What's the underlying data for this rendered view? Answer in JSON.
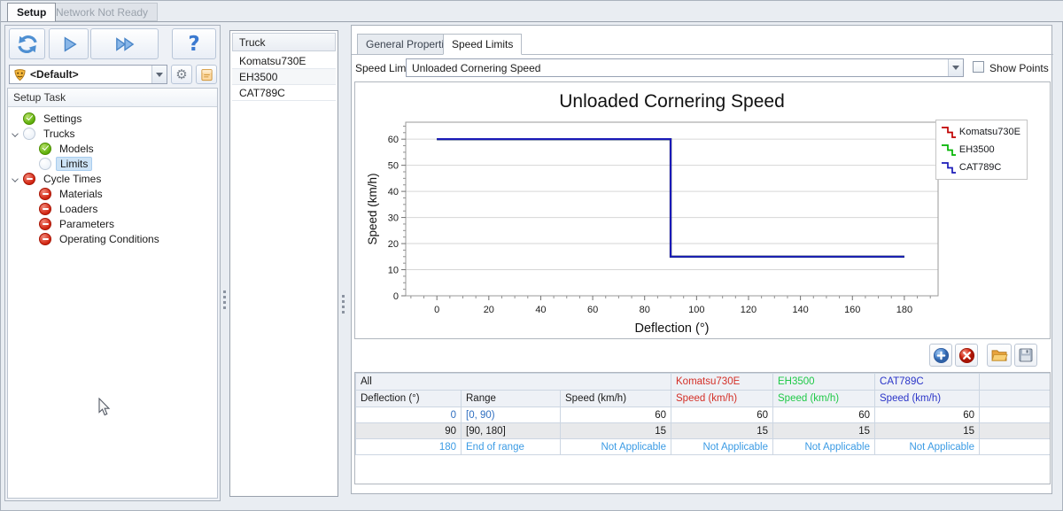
{
  "window": {
    "tabs": [
      {
        "label": "Setup",
        "active": true
      },
      {
        "label": "Network Not Ready",
        "active": false
      }
    ]
  },
  "left_panel": {
    "toolbar_icons": [
      "refresh-icon",
      "play-icon",
      "fast-forward-icon",
      "help-icon"
    ],
    "help_glyph": "?",
    "profile": {
      "icon": "mask-icon",
      "selected": "<Default>"
    },
    "side_buttons": [
      "gear-icon",
      "note-icon"
    ],
    "task_header": "Setup Task",
    "tree": [
      {
        "label": "Settings",
        "status": "done",
        "level": 1
      },
      {
        "label": "Trucks",
        "status": "pending",
        "level": 1,
        "expanded": true
      },
      {
        "label": "Models",
        "status": "done",
        "level": 2
      },
      {
        "label": "Limits",
        "status": "pending",
        "level": 2,
        "selected": true
      },
      {
        "label": "Cycle Times",
        "status": "blocked",
        "level": 1,
        "expanded": true
      },
      {
        "label": "Materials",
        "status": "blocked",
        "level": 2
      },
      {
        "label": "Loaders",
        "status": "blocked",
        "level": 2
      },
      {
        "label": "Parameters",
        "status": "blocked",
        "level": 2
      },
      {
        "label": "Operating Conditions",
        "status": "blocked",
        "level": 2
      }
    ]
  },
  "truck_list": {
    "header": "Truck",
    "items": [
      "Komatsu730E",
      "EH3500",
      "CAT789C"
    ]
  },
  "main": {
    "tabs": [
      {
        "label": "General Properties",
        "active": false
      },
      {
        "label": "Speed Limits",
        "active": true
      }
    ],
    "speed_limit_label": "Speed Limit",
    "speed_limit_value": "Unloaded Cornering Speed",
    "show_points_label": "Show Points",
    "show_points_checked": false,
    "action_icons": [
      "add-icon",
      "delete-icon",
      "open-folder-icon",
      "save-icon"
    ]
  },
  "chart_data": {
    "type": "line",
    "subtype": "step",
    "title": "Unloaded Cornering Speed",
    "xlabel": "Deflection (°)",
    "ylabel": "Speed (km/h)",
    "xlim": [
      -12,
      193
    ],
    "ylim": [
      0,
      66.5
    ],
    "x_ticks": [
      0,
      20,
      40,
      60,
      80,
      100,
      120,
      140,
      160,
      180
    ],
    "y_ticks": [
      0,
      10,
      20,
      30,
      40,
      50,
      60
    ],
    "x_minor_step": 5,
    "y_minor_step": 2.5,
    "grid": "horizontal-only",
    "legend_position": "top-right",
    "series": [
      {
        "name": "Komatsu730E",
        "color": "#c00000",
        "x": [
          0,
          90,
          90,
          180
        ],
        "y": [
          60,
          60,
          15,
          15
        ]
      },
      {
        "name": "EH3500",
        "color": "#00b400",
        "x": [
          0,
          90,
          90,
          180
        ],
        "y": [
          60,
          60,
          15,
          15
        ]
      },
      {
        "name": "CAT789C",
        "color": "#1a1ab8",
        "x": [
          0,
          90,
          90,
          180
        ],
        "y": [
          60,
          60,
          15,
          15
        ]
      }
    ]
  },
  "table": {
    "group": {
      "all": "All",
      "truck1": "Komatsu730E",
      "truck2": "EH3500",
      "truck3": "CAT789C"
    },
    "headers": {
      "deflection": "Deflection (°)",
      "range": "Range",
      "speed_all": "Speed (km/h)",
      "speed1": "Speed (km/h)",
      "speed2": "Speed (km/h)",
      "speed3": "Speed (km/h)"
    },
    "rows": [
      {
        "deflection": "0",
        "range": "[0, 90)",
        "speed_all": "60",
        "speed1": "60",
        "speed2": "60",
        "speed3": "60"
      },
      {
        "deflection": "90",
        "range": "[90, 180]",
        "speed_all": "15",
        "speed1": "15",
        "speed2": "15",
        "speed3": "15"
      },
      {
        "deflection": "180",
        "range": "End of range",
        "speed_all": "Not Applicable",
        "speed1": "Not Applicable",
        "speed2": "Not Applicable",
        "speed3": "Not Applicable"
      }
    ]
  },
  "colors": {
    "truck_red": "#d42f27",
    "truck_green": "#1fc947",
    "truck_blue": "#2a34c8",
    "link_blue": "#2f6fc0",
    "na_blue": "#3b9be4",
    "selection": "#cde3f6"
  }
}
